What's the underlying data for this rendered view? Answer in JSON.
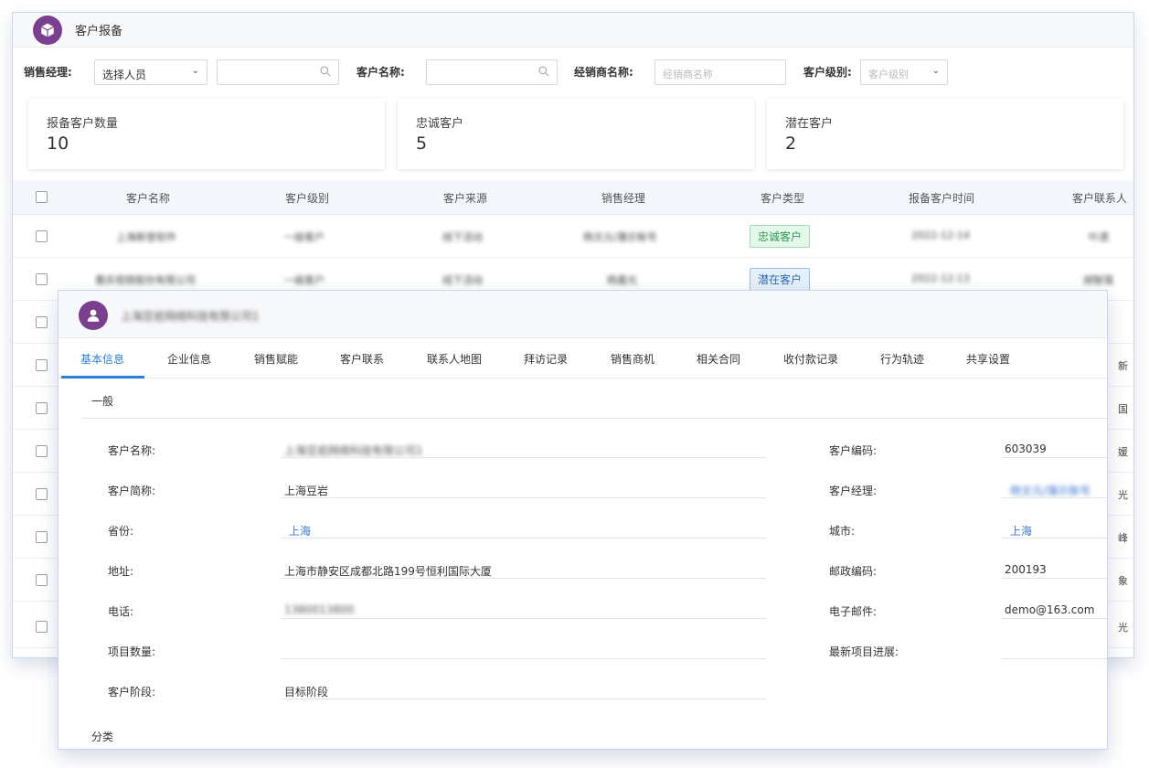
{
  "header": {
    "title": "客户报备"
  },
  "filters": {
    "sales_manager_label": "销售经理:",
    "sales_manager_select": "选择人员",
    "customer_name_label": "客户名称:",
    "dealer_name_label": "经销商名称:",
    "dealer_name_placeholder": "经销商名称",
    "customer_level_label": "客户级别:",
    "customer_level_placeholder": "客户级别"
  },
  "stats": [
    {
      "label": "报备客户数量",
      "value": "10"
    },
    {
      "label": "忠诚客户",
      "value": "5"
    },
    {
      "label": "潜在客户",
      "value": "2"
    }
  ],
  "table": {
    "columns": [
      "客户名称",
      "客户级别",
      "客户来源",
      "销售经理",
      "客户类型",
      "报备客户时间",
      "客户联系人"
    ],
    "rows": [
      {
        "name": "上海新誉软件",
        "level": "一级客户",
        "source": "线下活动",
        "manager": "杨文元/蒲示账号",
        "type": "忠诚客户",
        "date": "2022-12-14",
        "contact": "叶透"
      },
      {
        "name": "重庆视频股份有限公司",
        "level": "一级客户",
        "source": "线下活动",
        "manager": "杨嘉光",
        "type": "潜在客户",
        "date": "2022-12-13",
        "contact": "胡智强"
      }
    ],
    "right_edge_chars": [
      "新",
      "国",
      "媛",
      "光",
      "峰",
      "象",
      "光"
    ]
  },
  "detail": {
    "company_title": "上海豆岩网络科技有限公司1",
    "tabs": [
      "基本信息",
      "企业信息",
      "销售赋能",
      "客户联系",
      "联系人地图",
      "拜访记录",
      "销售商机",
      "相关合同",
      "收付款记录",
      "行为轨迹",
      "共享设置"
    ],
    "section_general": "一般",
    "section_category": "分类",
    "fields": {
      "customer_name_label": "客户名称:",
      "customer_name_value": "上海豆岩网络科技有限公司1",
      "customer_code_label": "客户编码:",
      "customer_code_value": "603039",
      "short_name_label": "客户简称:",
      "short_name_value": "上海豆岩",
      "customer_manager_label": "客户经理:",
      "customer_manager_value": "杨文元/蒲示账号",
      "province_label": "省份:",
      "province_value": "上海",
      "city_label": "城市:",
      "city_value": "上海",
      "address_label": "地址:",
      "address_value": "上海市静安区成都北路199号恒利国际大厦",
      "postal_code_label": "邮政编码:",
      "postal_code_value": "200193",
      "phone_label": "电话:",
      "phone_value": "1380013800",
      "email_label": "电子邮件:",
      "email_value": "demo@163.com",
      "project_count_label": "项目数量:",
      "latest_progress_label": "最新项目进展:",
      "stage_label": "客户阶段:",
      "stage_value": "目标阶段"
    }
  }
}
